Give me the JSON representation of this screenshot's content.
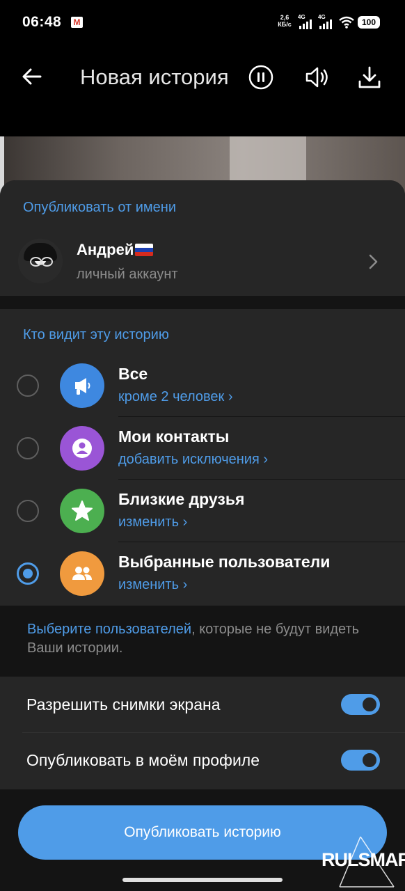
{
  "status_bar": {
    "time": "06:48",
    "speed_value": "2,6",
    "speed_unit": "КБ/с",
    "signal1": "4G",
    "signal2": "4G",
    "battery": "100"
  },
  "topbar": {
    "title": "Новая история"
  },
  "publish_as": {
    "header": "Опубликовать от имени",
    "name": "Андрей",
    "account_type": "личный аккаунт"
  },
  "audience": {
    "header": "Кто видит эту историю",
    "options": [
      {
        "label": "Все",
        "sub": "кроме 2 человек",
        "selected": false,
        "color": "#3e88e0",
        "icon": "megaphone-icon"
      },
      {
        "label": "Мои контакты",
        "sub": "добавить исключения",
        "selected": false,
        "color": "#9a55d6",
        "icon": "contact-icon"
      },
      {
        "label": "Близкие друзья",
        "sub": "изменить",
        "selected": false,
        "color": "#4caf50",
        "icon": "star-icon"
      },
      {
        "label": "Выбранные пользователи",
        "sub": "изменить",
        "selected": true,
        "color": "#f09a3e",
        "icon": "group-icon"
      }
    ]
  },
  "note": {
    "link": "Выберите пользователей",
    "text": ", которые не будут видеть Ваши истории."
  },
  "settings": {
    "allow_screenshots": {
      "label": "Разрешить снимки экрана",
      "on": true
    },
    "post_to_profile": {
      "label": "Опубликовать в моём профиле",
      "on": true
    }
  },
  "publish_button": "Опубликовать историю",
  "watermark": "RULSMART"
}
